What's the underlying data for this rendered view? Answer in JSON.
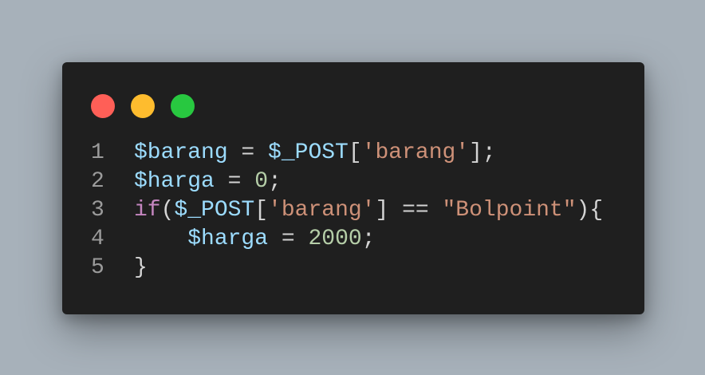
{
  "colors": {
    "background": "#a7b1ba",
    "window": "#1f1f1f",
    "close": "#ff5f57",
    "minimize": "#febc2e",
    "zoom": "#28c840",
    "line_number": "#9b9b9b",
    "variable": "#9cdcfe",
    "plain": "#d4d4d4",
    "string": "#ce9178",
    "number": "#b5cea8",
    "keyword": "#c586c0"
  },
  "window_controls": [
    {
      "name": "close-button",
      "icon": "close-dot-icon",
      "color": "#ff5f57"
    },
    {
      "name": "minimize-button",
      "icon": "minimize-dot-icon",
      "color": "#febc2e"
    },
    {
      "name": "zoom-button",
      "icon": "zoom-dot-icon",
      "color": "#28c840"
    }
  ],
  "code": {
    "lines": [
      {
        "number": "1",
        "tokens": [
          {
            "text": "$barang",
            "type": "variable"
          },
          {
            "text": " = ",
            "type": "plain"
          },
          {
            "text": "$_POST",
            "type": "variable"
          },
          {
            "text": "[",
            "type": "plain"
          },
          {
            "text": "'barang'",
            "type": "string"
          },
          {
            "text": "];",
            "type": "plain"
          }
        ]
      },
      {
        "number": "2",
        "tokens": [
          {
            "text": "$harga",
            "type": "variable"
          },
          {
            "text": " = ",
            "type": "plain"
          },
          {
            "text": "0",
            "type": "number"
          },
          {
            "text": ";",
            "type": "plain"
          }
        ]
      },
      {
        "number": "3",
        "tokens": [
          {
            "text": "if",
            "type": "keyword"
          },
          {
            "text": "(",
            "type": "plain"
          },
          {
            "text": "$_POST",
            "type": "variable"
          },
          {
            "text": "[",
            "type": "plain"
          },
          {
            "text": "'barang'",
            "type": "string"
          },
          {
            "text": "] == ",
            "type": "plain"
          },
          {
            "text": "\"Bolpoint\"",
            "type": "string"
          },
          {
            "text": "){",
            "type": "plain"
          }
        ]
      },
      {
        "number": "4",
        "tokens": [
          {
            "text": "    ",
            "type": "plain"
          },
          {
            "text": "$harga",
            "type": "variable"
          },
          {
            "text": " = ",
            "type": "plain"
          },
          {
            "text": "2000",
            "type": "number"
          },
          {
            "text": ";",
            "type": "plain"
          }
        ]
      },
      {
        "number": "5",
        "tokens": [
          {
            "text": "}",
            "type": "plain"
          }
        ]
      }
    ]
  }
}
